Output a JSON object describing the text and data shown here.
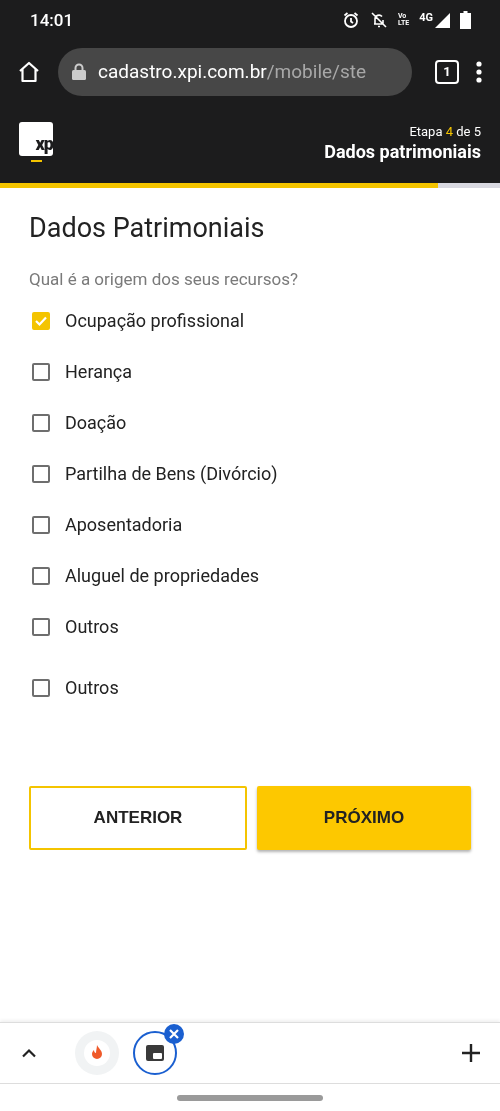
{
  "status_bar": {
    "time": "14:01",
    "volte_top": "Vo",
    "volte_bottom": "LTE",
    "network": "4G"
  },
  "browser": {
    "url_host": "cadastro.xpi.com.br",
    "url_path": "/mobile/ste",
    "tab_count": "1"
  },
  "header": {
    "logo": "xp",
    "step_prefix": "Etapa",
    "step_current": "4",
    "step_suffix": "de 5",
    "step_title": "Dados patrimoniais",
    "progress": {
      "level": 0.876
    }
  },
  "form": {
    "title": "Dados Patrimoniais",
    "question": "Qual é a origem dos seus recursos?",
    "options": [
      {
        "label": "Ocupação profissional",
        "checked": true
      },
      {
        "label": "Herança",
        "checked": false
      },
      {
        "label": "Doação",
        "checked": false
      },
      {
        "label": "Partilha de Bens (Divórcio)",
        "checked": false
      },
      {
        "label": "Aposentadoria",
        "checked": false
      },
      {
        "label": "Aluguel de propriedades",
        "checked": false
      },
      {
        "label": "Outros",
        "checked": false
      },
      {
        "label": "Outros",
        "checked": false
      }
    ],
    "buttons": [
      {
        "label": "ANTERIOR",
        "kind": "outline"
      },
      {
        "label": "PRÓXIMO",
        "kind": "filled"
      }
    ]
  },
  "tab_group": {
    "tabs": [
      {
        "kind": "fire",
        "selected": false
      },
      {
        "kind": "site",
        "selected": true
      }
    ]
  }
}
